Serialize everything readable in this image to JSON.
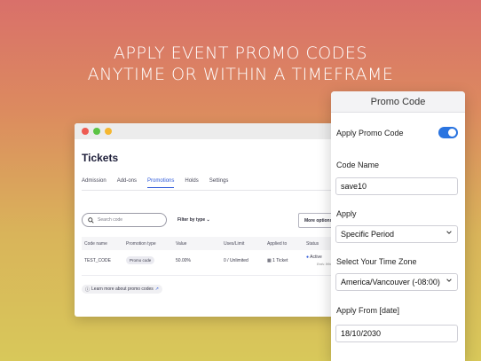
{
  "headline": {
    "line1": "APPLY EVENT PROMO CODES",
    "line2": "ANYTIME OR WITHIN A TIMEFRAME"
  },
  "window": {
    "title": "Tickets",
    "tabs": [
      {
        "label": "Admission",
        "active": false
      },
      {
        "label": "Add-ons",
        "active": false
      },
      {
        "label": "Promotions",
        "active": true
      },
      {
        "label": "Holds",
        "active": false
      },
      {
        "label": "Settings",
        "active": false
      }
    ],
    "search_placeholder": "Search code",
    "filter_label": "Filter by type",
    "more_options_label": "More options",
    "columns": [
      "Code name",
      "Promotion type",
      "Value",
      "Uses/Limit",
      "Applied to",
      "Status"
    ],
    "rows": [
      {
        "code": "TEST_CODE",
        "type": "Promo code",
        "value": "50.00%",
        "uses": "0 / Unlimited",
        "applied": "1 Ticket",
        "status": "Active",
        "status_note": "Ends: When"
      }
    ],
    "learn_more": "Learn more about promo codes"
  },
  "panel": {
    "title": "Promo Code",
    "apply_toggle_label": "Apply Promo Code",
    "apply_toggle_on": true,
    "code_name_label": "Code Name",
    "code_name_value": "save10",
    "apply_label": "Apply",
    "apply_value": "Specific Period",
    "timezone_label": "Select Your Time Zone",
    "timezone_value": "America/Vancouver (-08:00)",
    "apply_from_label": "Apply From [date]",
    "apply_from_value": "18/10/2030"
  },
  "colors": {
    "accent": "#2e59d9",
    "toggle": "#2a74e0"
  }
}
